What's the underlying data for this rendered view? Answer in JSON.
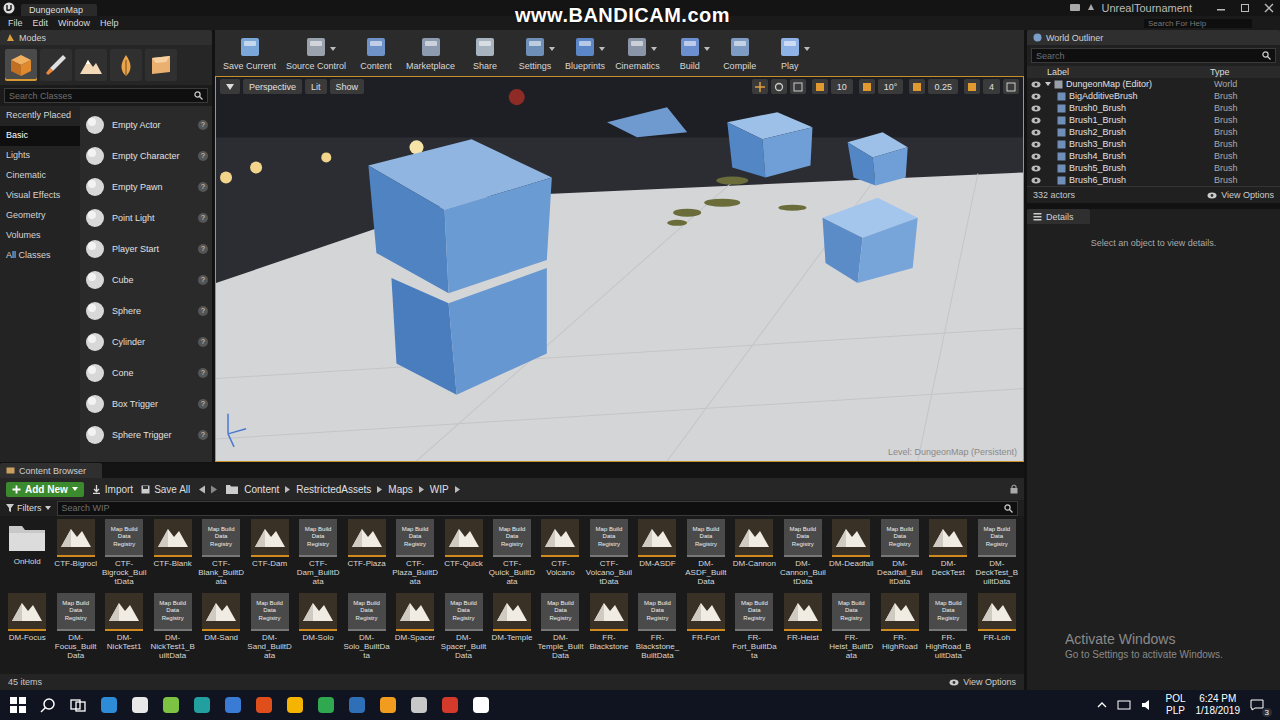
{
  "watermark": "www.BANDICAM.com",
  "title_bar": {
    "tab": "DungeonMap",
    "project": "UnrealTournament",
    "search_placeholder": "Search For Help"
  },
  "menu": [
    "File",
    "Edit",
    "Window",
    "Help"
  ],
  "modes": {
    "title": "Modes",
    "tools": [
      {
        "selected": true
      },
      {
        "selected": false
      },
      {
        "selected": false
      },
      {
        "selected": false
      },
      {
        "selected": false
      }
    ],
    "search_placeholder": "Search Classes",
    "categories": [
      {
        "label": "Recently Placed",
        "selected": false
      },
      {
        "label": "Basic",
        "selected": true
      },
      {
        "label": "Lights",
        "selected": false
      },
      {
        "label": "Cinematic",
        "selected": false
      },
      {
        "label": "Visual Effects",
        "selected": false
      },
      {
        "label": "Geometry",
        "selected": false
      },
      {
        "label": "Volumes",
        "selected": false
      },
      {
        "label": "All Classes",
        "selected": false
      }
    ],
    "items": [
      "Empty Actor",
      "Empty Character",
      "Empty Pawn",
      "Point Light",
      "Player Start",
      "Cube",
      "Sphere",
      "Cylinder",
      "Cone",
      "Box Trigger",
      "Sphere Trigger"
    ],
    "help_glyph": "?"
  },
  "toolbar": [
    {
      "label": "Save Current",
      "dropdown": false
    },
    {
      "label": "Source Control",
      "dropdown": true
    },
    {
      "label": "Content",
      "dropdown": false
    },
    {
      "label": "Marketplace",
      "dropdown": false
    },
    {
      "label": "Share",
      "dropdown": false
    },
    {
      "label": "Settings",
      "dropdown": true
    },
    {
      "label": "Blueprints",
      "dropdown": true
    },
    {
      "label": "Cinematics",
      "dropdown": true
    },
    {
      "label": "Build",
      "dropdown": true
    },
    {
      "label": "Compile",
      "dropdown": false
    },
    {
      "label": "Play",
      "dropdown": true
    }
  ],
  "viewport": {
    "view": "Perspective",
    "lighting": "Lit",
    "show": "Show",
    "snap_values": [
      "10",
      "10°",
      "0.25",
      "4"
    ],
    "level": "Level:  DungeonMap (Persistent)"
  },
  "outliner": {
    "title": "World Outliner",
    "search_placeholder": "Search",
    "columns": [
      "Label",
      "Type"
    ],
    "rows": [
      {
        "label": "DungeonMap (Editor)",
        "type": "World",
        "depth": 0,
        "expanded": true
      },
      {
        "label": "BigAdditiveBrush",
        "type": "Brush",
        "depth": 1,
        "expanded": false
      },
      {
        "label": "Brush0_Brush",
        "type": "Brush",
        "depth": 1,
        "expanded": false
      },
      {
        "label": "Brush1_Brush",
        "type": "Brush",
        "depth": 1,
        "expanded": false
      },
      {
        "label": "Brush2_Brush",
        "type": "Brush",
        "depth": 1,
        "expanded": false
      },
      {
        "label": "Brush3_Brush",
        "type": "Brush",
        "depth": 1,
        "expanded": false
      },
      {
        "label": "Brush4_Brush",
        "type": "Brush",
        "depth": 1,
        "expanded": false
      },
      {
        "label": "Brush5_Brush",
        "type": "Brush",
        "depth": 1,
        "expanded": false
      },
      {
        "label": "Brush6_Brush",
        "type": "Brush",
        "depth": 1,
        "expanded": false
      }
    ],
    "count": "332 actors",
    "view_options": "View Options"
  },
  "details": {
    "title": "Details",
    "empty": "Select an object to view details."
  },
  "content_browser": {
    "title": "Content Browser",
    "add_new": "Add New",
    "import": "Import",
    "save_all": "Save All",
    "path": [
      "Content",
      "RestrictedAssets",
      "Maps",
      "WIP"
    ],
    "filters": "Filters",
    "search_placeholder": "Search WIP",
    "thumb_text": "Map Build Data Registry",
    "items": [
      {
        "name": "OnHold",
        "kind": "folder"
      },
      {
        "name": "CTF-Bigrocl",
        "kind": "map"
      },
      {
        "name": "CTF-Bigrock_BuiltData",
        "kind": "build"
      },
      {
        "name": "CTF-Blank",
        "kind": "map"
      },
      {
        "name": "CTF-Blank_BuiltData",
        "kind": "build"
      },
      {
        "name": "CTF-Dam",
        "kind": "map"
      },
      {
        "name": "CTF-Dam_BuiltData",
        "kind": "build"
      },
      {
        "name": "CTF-Plaza",
        "kind": "map"
      },
      {
        "name": "CTF-Plaza_BuiltData",
        "kind": "build"
      },
      {
        "name": "CTF-Quick",
        "kind": "map"
      },
      {
        "name": "CTF-Quick_BuiltData",
        "kind": "build"
      },
      {
        "name": "CTF-Volcano",
        "kind": "map"
      },
      {
        "name": "CTF-Volcano_BuiltData",
        "kind": "build"
      },
      {
        "name": "DM-ASDF",
        "kind": "map"
      },
      {
        "name": "DM-ASDF_BuiltData",
        "kind": "build"
      },
      {
        "name": "DM-Cannon",
        "kind": "map"
      },
      {
        "name": "DM-Cannon_BuiltData",
        "kind": "build"
      },
      {
        "name": "DM-Deadfall",
        "kind": "map"
      },
      {
        "name": "DM-Deadfall_BuiltData",
        "kind": "build"
      },
      {
        "name": "DM-DeckTest",
        "kind": "map"
      },
      {
        "name": "DM-DeckTest_BuiltData",
        "kind": "build"
      },
      {
        "name": "DM-Focus",
        "kind": "map"
      },
      {
        "name": "DM-Focus_BuiltData",
        "kind": "build"
      },
      {
        "name": "DM-NickTest1",
        "kind": "map"
      },
      {
        "name": "DM-NickTest1_BuiltData",
        "kind": "build"
      },
      {
        "name": "DM-Sand",
        "kind": "map"
      },
      {
        "name": "DM-Sand_BuiltData",
        "kind": "build"
      },
      {
        "name": "DM-Solo",
        "kind": "map"
      },
      {
        "name": "DM-Solo_BuiltData",
        "kind": "build"
      },
      {
        "name": "DM-Spacer",
        "kind": "map"
      },
      {
        "name": "DM-Spacer_BuiltData",
        "kind": "build"
      },
      {
        "name": "DM-Temple",
        "kind": "map"
      },
      {
        "name": "DM-Temple_BuiltData",
        "kind": "build"
      },
      {
        "name": "FR-Blackstone",
        "kind": "map"
      },
      {
        "name": "FR-Blackstone_BuiltData",
        "kind": "build"
      },
      {
        "name": "FR-Fort",
        "kind": "map"
      },
      {
        "name": "FR-Fort_BuiltData",
        "kind": "build"
      },
      {
        "name": "FR-Heist",
        "kind": "map"
      },
      {
        "name": "FR-Heist_BuiltData",
        "kind": "build"
      },
      {
        "name": "FR-HighRoad",
        "kind": "map"
      },
      {
        "name": "FR-HighRoad_BuiltData",
        "kind": "build"
      },
      {
        "name": "FR-Loh",
        "kind": "map"
      }
    ],
    "count": "45 items",
    "view_options": "View Options"
  },
  "windows_watermark": {
    "title": "Activate Windows",
    "subtitle": "Go to Settings to activate Windows."
  },
  "taskbar": {
    "language": "POL",
    "layout": "PLP",
    "time": "6:24 PM",
    "date": "1/18/2019",
    "notifications": "3"
  }
}
